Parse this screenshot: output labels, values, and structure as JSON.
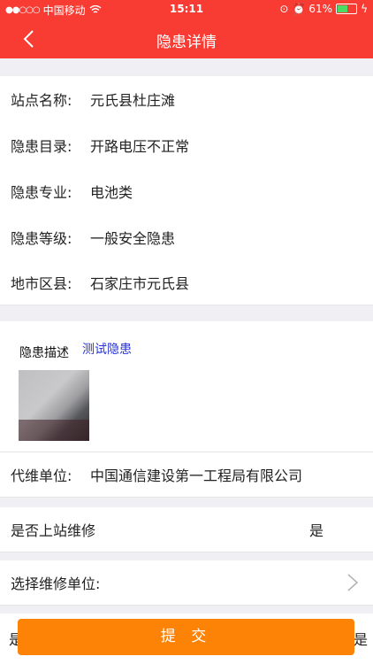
{
  "status_bar": {
    "carrier": "中国移动",
    "time": "15:11",
    "battery": "61%",
    "battery_level": 0.61
  },
  "nav": {
    "title": "隐患详情"
  },
  "details": [
    {
      "label": "站点名称:",
      "value": "元氏县杜庄滩"
    },
    {
      "label": "隐患目录:",
      "value": "开路电压不正常"
    },
    {
      "label": "隐患专业:",
      "value": "电池类"
    },
    {
      "label": "隐患等级:",
      "value": "一般安全隐患"
    },
    {
      "label": "地市区县:",
      "value": "石家庄市元氏县"
    }
  ],
  "description": {
    "label": "隐患描述",
    "text": "测试隐患"
  },
  "maintenance_unit": {
    "label": "代维单位:",
    "value": "中国通信建设第一工程局有限公司"
  },
  "onsite_repair": {
    "label": "是否上站维修",
    "value": "是"
  },
  "select_repair_unit": {
    "label": "选择维修单位:"
  },
  "partial_row": {
    "left": "是",
    "right": "是"
  },
  "submit": {
    "label": "提 交"
  },
  "colors": {
    "primary": "#f83b33",
    "submit": "#fd8307",
    "link": "#2633d6"
  }
}
